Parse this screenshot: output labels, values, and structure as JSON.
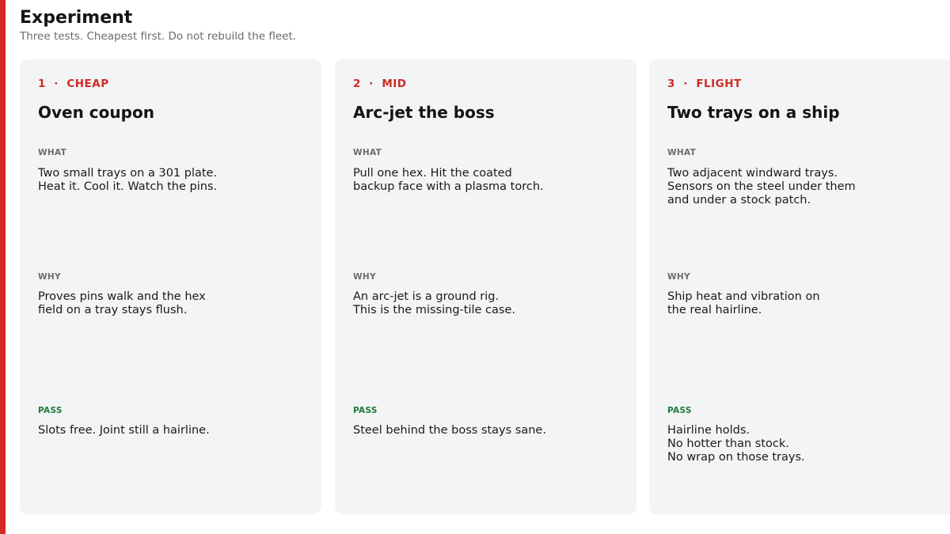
{
  "header": {
    "title": "Experiment",
    "subtitle": "Three tests. Cheapest first. Do not rebuild the fleet."
  },
  "labels": {
    "what": "WHAT",
    "why": "WHY",
    "pass": "PASS"
  },
  "colors": {
    "accent": "#d42a25",
    "kicker": "#cc2b23",
    "pass": "#1f7a3a",
    "card_bg": "#f3f4f6"
  },
  "cards": [
    {
      "kicker": "1  ·  CHEAP",
      "title": "Oven coupon",
      "what": "Two small trays on a 301 plate.\nHeat it. Cool it. Watch the pins.",
      "why": "Proves pins walk and the hex\nfield on a tray stays flush.",
      "pass": "Slots free. Joint still a hairline."
    },
    {
      "kicker": "2  ·  MID",
      "title": "Arc-jet the boss",
      "what": "Pull one hex. Hit the coated\nbackup face with a plasma torch.",
      "why": "An arc-jet is a ground rig.\nThis is the missing-tile case.",
      "pass": "Steel behind the boss stays sane."
    },
    {
      "kicker": "3  ·  FLIGHT",
      "title": "Two trays on a ship",
      "what": "Two adjacent windward trays.\nSensors on the steel under them\nand under a stock patch.",
      "why": "Ship heat and vibration on\nthe real hairline.",
      "pass": "Hairline holds.\nNo hotter than stock.\nNo wrap on those trays."
    }
  ]
}
